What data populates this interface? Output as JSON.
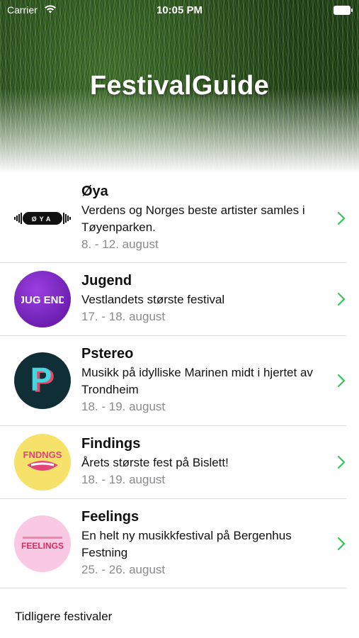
{
  "status_bar": {
    "carrier": "Carrier",
    "time": "10:05 PM"
  },
  "app_title": "FestivalGuide",
  "festivals": [
    {
      "name": "Øya",
      "description": "Verdens og Norges beste artister samles i Tøyenparken.",
      "dates": "8. - 12. august",
      "logo_text": "ØYA",
      "logo_icon": "oya-logo-icon"
    },
    {
      "name": "Jugend",
      "description": "Vestlandets største festival",
      "dates": "17. - 18. august",
      "logo_text": "JUG END",
      "logo_icon": "jugend-logo-icon"
    },
    {
      "name": "Pstereo",
      "description": "Musikk på idylliske Marinen midt i hjertet av Trondheim",
      "dates": "18. - 19. august",
      "logo_text": "P",
      "logo_icon": "pstereo-logo-icon"
    },
    {
      "name": "Findings",
      "description": "Årets største fest på Bislett!",
      "dates": "18. - 19. august",
      "logo_text": "FNDNGS",
      "logo_icon": "findings-logo-icon"
    },
    {
      "name": "Feelings",
      "description": "En helt ny musikkfestival på Bergenhus Festning",
      "dates": "25. - 26. august",
      "logo_text": "FEELINGS",
      "logo_icon": "feelings-logo-icon"
    }
  ],
  "footer": {
    "past_festivals_label": "Tidligere festivaler"
  },
  "colors": {
    "accent": "#34c759",
    "secondary_text": "#8a8a8e"
  }
}
